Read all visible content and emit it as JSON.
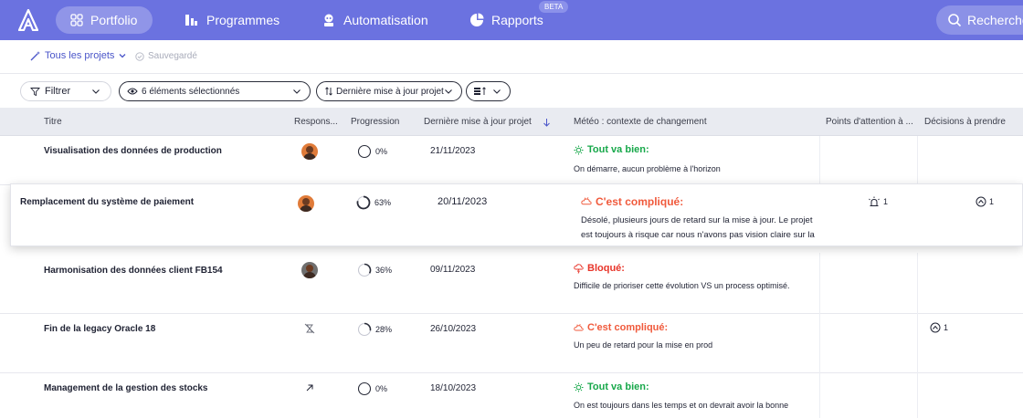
{
  "nav": {
    "items": [
      {
        "label": "Portfolio",
        "active": true
      },
      {
        "label": "Programmes"
      },
      {
        "label": "Automatisation"
      },
      {
        "label": "Rapports"
      }
    ],
    "beta": "BETA",
    "search": "Rechercher"
  },
  "toolbar": {
    "projects": "Tous les projets",
    "saved": "Sauvegardé",
    "filter": "Filtrer",
    "selection": "6 éléments sélectionnés",
    "updated": "Dernière mise à jour projet"
  },
  "columns": [
    "Titre",
    "Respons...",
    "Progression",
    "Dernière mise à jour projet",
    "Météo : contexte de changement",
    "Points d'attention à ...",
    "Décisions à prendre"
  ],
  "rows": [
    {
      "title": "Visualisation des données de production",
      "progress": "0%",
      "progress_value": 0,
      "date": "21/11/2023",
      "status": "Tout va bien:",
      "status_type": "ok",
      "text": [
        "On démarre, aucun problème à l'horizon"
      ],
      "attention": "",
      "decisions": "",
      "owner": "avatar"
    },
    {
      "title": "Remplacement du système de paiement",
      "progress": "63%",
      "progress_value": 0.63,
      "date": "20/11/2023",
      "status": "C'est compliqué:",
      "status_type": "warn",
      "text": [
        "Désolé, plusieurs jours de retard sur la mise à jour. Le projet",
        "est toujours à risque car nous n'avons pas vision claire sur la"
      ],
      "attention": "1",
      "decisions": "1",
      "owner": "avatar"
    },
    {
      "title": "Harmonisation des données client FB154",
      "progress": "36%",
      "progress_value": 0.36,
      "date": "09/11/2023",
      "status": "Bloqué:",
      "status_type": "blocked",
      "text": [
        "Difficile de prioriser cette évolution VS un process optimisé."
      ],
      "attention": "",
      "decisions": "",
      "owner": "avatar-grey"
    },
    {
      "title": "Fin de la legacy Oracle 18",
      "progress": "28%",
      "progress_value": 0.28,
      "date": "26/10/2023",
      "status": "C'est compliqué:",
      "status_type": "warn",
      "text": [
        "Un peu de retard pour la mise en prod"
      ],
      "attention": "",
      "decisions": "1",
      "owner": "none-icon"
    },
    {
      "title": "Management de la gestion des stocks",
      "progress": "0%",
      "progress_value": 0,
      "date": "18/10/2023",
      "status": "Tout va bien:",
      "status_type": "ok",
      "text": [
        "On est toujours dans les temps et on devrait avoir la bonne"
      ],
      "attention": "",
      "decisions": "",
      "owner": "arrow-icon"
    }
  ],
  "colors": {
    "nav": "#6b72e0",
    "ok": "#17a84a",
    "warn": "#f05a3c",
    "blocked": "#e8352a",
    "link": "#4a55c9"
  }
}
